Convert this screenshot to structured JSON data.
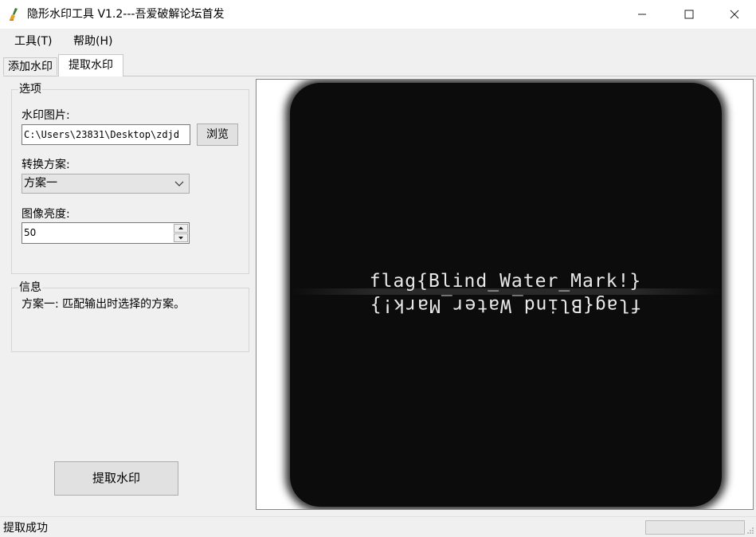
{
  "window": {
    "title": "隐形水印工具 V1.2---吾爱破解论坛首发",
    "minimize_icon": "minimize-icon",
    "maximize_icon": "maximize-icon",
    "close_icon": "close-icon",
    "app_icon": "app-brush-icon"
  },
  "menu": {
    "tools": "工具(T)",
    "help": "帮助(H)"
  },
  "tabs": [
    {
      "label": "添加水印",
      "selected": false
    },
    {
      "label": "提取水印",
      "selected": true
    }
  ],
  "options": {
    "group_title": "选项",
    "watermark_label": "水印图片:",
    "watermark_path": "C:\\Users\\23831\\Desktop\\zdjd",
    "browse_label": "浏览",
    "scheme_label": "转换方案:",
    "scheme_value": "方案一",
    "brightness_label": "图像亮度:",
    "brightness_value": "50"
  },
  "info": {
    "group_title": "信息",
    "text": "方案一: 匹配输出时选择的方案。"
  },
  "actions": {
    "extract_label": "提取水印"
  },
  "preview": {
    "watermark_text": "flag{Blind_Water_Mark!}",
    "mirrored_text": "flag{Blind_Water_Mark!}"
  },
  "status": {
    "text": "提取成功"
  },
  "colors": {
    "window_bg": "#f0f0f0",
    "image_bg": "#0c0c0c",
    "watermark_text": "#e8e8e8"
  }
}
